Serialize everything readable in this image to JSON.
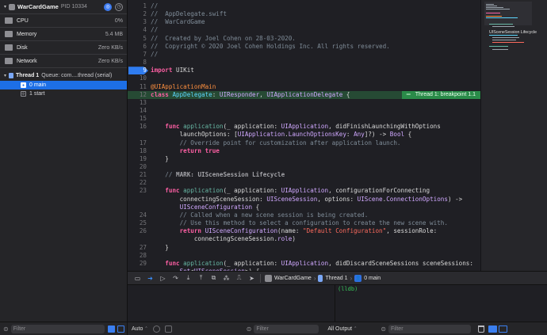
{
  "process": {
    "name": "WarCardGame",
    "pid": "PID 10334"
  },
  "gauges": [
    {
      "label": "CPU",
      "value": "0%",
      "icon": "cpu-gauge-icon"
    },
    {
      "label": "Memory",
      "value": "5.4 MB",
      "icon": "memory-gauge-icon"
    },
    {
      "label": "Disk",
      "value": "Zero KB/s",
      "icon": "disk-gauge-icon"
    },
    {
      "label": "Network",
      "value": "Zero KB/s",
      "icon": "network-gauge-icon"
    }
  ],
  "thread": {
    "label": "Thread 1",
    "queue": "Queue: com....thread (serial)"
  },
  "frames": [
    {
      "label": "0 main",
      "selected": true
    },
    {
      "label": "1 start",
      "selected": false
    }
  ],
  "nav_filter": {
    "placeholder": "Filter"
  },
  "editor": {
    "breakpoint_badge": "Thread 1: breakpoint 1.1",
    "lines": [
      {
        "n": "1",
        "t": [
          [
            "cm",
            "//"
          ]
        ]
      },
      {
        "n": "2",
        "t": [
          [
            "cm",
            "//  AppDelegate.swift"
          ]
        ]
      },
      {
        "n": "3",
        "t": [
          [
            "cm",
            "//  WarCardGame"
          ]
        ]
      },
      {
        "n": "4",
        "t": [
          [
            "cm",
            "//"
          ]
        ]
      },
      {
        "n": "5",
        "t": [
          [
            "cm",
            "//  Created by Joel Cohen on 28-03-2020."
          ]
        ]
      },
      {
        "n": "6",
        "t": [
          [
            "cm",
            "//  Copyright © 2020 Joel Cohen Holdings Inc. All rights reserved."
          ]
        ]
      },
      {
        "n": "7",
        "t": [
          [
            "cm",
            "//"
          ]
        ]
      },
      {
        "n": "8",
        "t": []
      },
      {
        "n": "9",
        "bp": true,
        "t": [
          [
            "kw",
            "import"
          ],
          [
            "pl",
            " UIKit"
          ]
        ]
      },
      {
        "n": "10",
        "t": []
      },
      {
        "n": "11",
        "t": [
          [
            "attr",
            "@UIApplicationMain"
          ]
        ]
      },
      {
        "n": "12",
        "hl": true,
        "t": [
          [
            "kw",
            "class"
          ],
          [
            "pl",
            " "
          ],
          [
            "ty",
            "AppDelegate"
          ],
          [
            "pl",
            ": "
          ],
          [
            "lib",
            "UIResponder"
          ],
          [
            "pl",
            ", "
          ],
          [
            "lib",
            "UIApplicationDelegate"
          ],
          [
            "pl",
            " {"
          ]
        ]
      },
      {
        "n": "13",
        "t": []
      },
      {
        "n": "14",
        "t": []
      },
      {
        "n": "15",
        "t": []
      },
      {
        "n": "16",
        "t": [
          [
            "pl",
            "    "
          ],
          [
            "kw",
            "func"
          ],
          [
            "pl",
            " "
          ],
          [
            "fn",
            "application"
          ],
          [
            "pl",
            "(_ application: "
          ],
          [
            "lib",
            "UIApplication"
          ],
          [
            "pl",
            ", didFinishLaunchingWithOptions"
          ]
        ]
      },
      {
        "n": "",
        "t": [
          [
            "pl",
            "        launchOptions: ["
          ],
          [
            "lib",
            "UIApplication"
          ],
          [
            "pl",
            "."
          ],
          [
            "lib",
            "LaunchOptionsKey"
          ],
          [
            "pl",
            ": "
          ],
          [
            "lib",
            "Any"
          ],
          [
            "pl",
            "]?) -> "
          ],
          [
            "lib",
            "Bool"
          ],
          [
            "pl",
            " {"
          ]
        ]
      },
      {
        "n": "17",
        "t": [
          [
            "pl",
            "        "
          ],
          [
            "cm",
            "// Override point for customization after application launch."
          ]
        ]
      },
      {
        "n": "18",
        "t": [
          [
            "pl",
            "        "
          ],
          [
            "kw",
            "return"
          ],
          [
            "pl",
            " "
          ],
          [
            "kw",
            "true"
          ]
        ]
      },
      {
        "n": "19",
        "t": [
          [
            "pl",
            "    }"
          ]
        ]
      },
      {
        "n": "20",
        "t": []
      },
      {
        "n": "21",
        "t": [
          [
            "pl",
            "    "
          ],
          [
            "cm",
            "// "
          ],
          [
            "mark",
            "MARK: UISceneSession Lifecycle"
          ]
        ]
      },
      {
        "n": "22",
        "t": []
      },
      {
        "n": "23",
        "t": [
          [
            "pl",
            "    "
          ],
          [
            "kw",
            "func"
          ],
          [
            "pl",
            " "
          ],
          [
            "fn",
            "application"
          ],
          [
            "pl",
            "(_ application: "
          ],
          [
            "lib",
            "UIApplication"
          ],
          [
            "pl",
            ", configurationForConnecting"
          ]
        ]
      },
      {
        "n": "",
        "t": [
          [
            "pl",
            "        connectingSceneSession: "
          ],
          [
            "lib",
            "UISceneSession"
          ],
          [
            "pl",
            ", options: "
          ],
          [
            "lib",
            "UIScene"
          ],
          [
            "pl",
            "."
          ],
          [
            "lib",
            "ConnectionOptions"
          ],
          [
            "pl",
            ") ->"
          ]
        ]
      },
      {
        "n": "",
        "t": [
          [
            "pl",
            "        "
          ],
          [
            "lib",
            "UISceneConfiguration"
          ],
          [
            "pl",
            " {"
          ]
        ]
      },
      {
        "n": "24",
        "t": [
          [
            "pl",
            "        "
          ],
          [
            "cm",
            "// Called when a new scene session is being created."
          ]
        ]
      },
      {
        "n": "25",
        "t": [
          [
            "pl",
            "        "
          ],
          [
            "cm",
            "// Use this method to select a configuration to create the new scene with."
          ]
        ]
      },
      {
        "n": "26",
        "t": [
          [
            "pl",
            "        "
          ],
          [
            "kw",
            "return"
          ],
          [
            "pl",
            " "
          ],
          [
            "lib",
            "UISceneConfiguration"
          ],
          [
            "pl",
            "(name: "
          ],
          [
            "str",
            "\"Default Configuration\""
          ],
          [
            "pl",
            ", sessionRole:"
          ]
        ]
      },
      {
        "n": "",
        "t": [
          [
            "pl",
            "            connectingSceneSession."
          ],
          [
            "lib",
            "role"
          ],
          [
            "pl",
            ")"
          ]
        ]
      },
      {
        "n": "27",
        "t": [
          [
            "pl",
            "    }"
          ]
        ]
      },
      {
        "n": "28",
        "t": []
      },
      {
        "n": "29",
        "t": [
          [
            "pl",
            "    "
          ],
          [
            "kw",
            "func"
          ],
          [
            "pl",
            " "
          ],
          [
            "fn",
            "application"
          ],
          [
            "pl",
            "(_ application: "
          ],
          [
            "lib",
            "UIApplication"
          ],
          [
            "pl",
            ", didDiscardSceneSessions sceneSessions:"
          ]
        ]
      },
      {
        "n": "",
        "t": [
          [
            "pl",
            "        "
          ],
          [
            "lib",
            "Set"
          ],
          [
            "pl",
            "<"
          ],
          [
            "lib",
            "UISceneSession"
          ],
          [
            "pl",
            ">) {"
          ]
        ]
      }
    ]
  },
  "minimap": {
    "label": "UISceneSession Lifecycle"
  },
  "debugbar": {
    "crumbs": [
      {
        "label": "WarCardGame",
        "icon": "app-icon"
      },
      {
        "label": "Thread 1",
        "icon": "thread-icon"
      },
      {
        "label": "0 main",
        "icon": "frame-user-icon"
      }
    ]
  },
  "console": {
    "prompt": "(lldb)"
  },
  "bottombar": {
    "vars_scope": "Auto",
    "vars_filter_placeholder": "Filter",
    "console_scope": "All Output",
    "console_filter_placeholder": "Filter"
  },
  "colors": {
    "selection": "#1d6fe6",
    "breakpoint": "#2f7cf0",
    "breakpoint_line": "#264a34",
    "badge": "#2a8b49",
    "lldb_prompt": "#37c85a"
  }
}
